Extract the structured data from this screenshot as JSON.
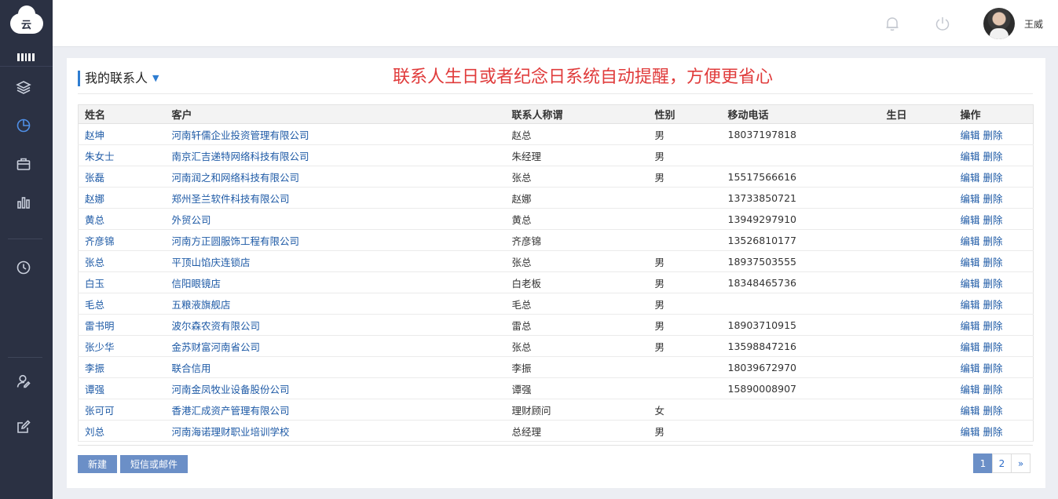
{
  "sidebar": {
    "logo_text": "云",
    "items": [
      {
        "icon": "layers-icon"
      },
      {
        "icon": "pie-chart-icon",
        "active": true
      },
      {
        "icon": "briefcase-icon"
      },
      {
        "icon": "bar-chart-icon"
      },
      {
        "icon": "clock-icon"
      },
      {
        "icon": "user-edit-icon"
      },
      {
        "icon": "edit-icon"
      }
    ]
  },
  "header": {
    "username": "王威"
  },
  "panel": {
    "title": "我的联系人",
    "promo": "联系人生日或者纪念日系统自动提醒，方便更省心"
  },
  "table": {
    "columns": [
      "姓名",
      "客户",
      "联系人称谓",
      "性别",
      "移动电话",
      "生日",
      "操作"
    ],
    "edit_label": "编辑",
    "delete_label": "删除",
    "rows": [
      [
        "赵坤",
        "河南轩儒企业投资管理有限公司",
        "赵总",
        "男",
        "18037197818",
        ""
      ],
      [
        "朱女士",
        "南京汇吉递特网络科技有限公司",
        "朱经理",
        "男",
        "",
        ""
      ],
      [
        "张磊",
        "河南润之和网络科技有限公司",
        "张总",
        "男",
        "15517566616",
        ""
      ],
      [
        "赵娜",
        "郑州圣兰软件科技有限公司",
        "赵娜",
        "",
        "13733850721",
        ""
      ],
      [
        "黄总",
        "外贸公司",
        "黄总",
        "",
        "13949297910",
        ""
      ],
      [
        "齐彦锦",
        "河南方正圆服饰工程有限公司",
        "齐彦锦",
        "",
        "13526810177",
        ""
      ],
      [
        "张总",
        "平顶山馅庆连锁店",
        "张总",
        "男",
        "18937503555",
        ""
      ],
      [
        "白玉",
        "信阳眼镜店",
        "白老板",
        "男",
        "18348465736",
        ""
      ],
      [
        "毛总",
        "五粮液旗舰店",
        "毛总",
        "男",
        "",
        ""
      ],
      [
        "雷书明",
        "波尔森农资有限公司",
        "雷总",
        "男",
        "18903710915",
        ""
      ],
      [
        "张少华",
        "金苏财富河南省公司",
        "张总",
        "男",
        "13598847216",
        ""
      ],
      [
        "李振",
        "联合信用",
        "李振",
        "",
        "18039672970",
        ""
      ],
      [
        "谭强",
        "河南金凤牧业设备股份公司",
        "谭强",
        "",
        "15890008907",
        ""
      ],
      [
        "张可可",
        "香港汇成资产管理有限公司",
        "理财顾问",
        "女",
        "",
        ""
      ],
      [
        "刘总",
        "河南海诺理财职业培训学校",
        "总经理",
        "男",
        "",
        ""
      ]
    ]
  },
  "actions": {
    "new_label": "新建",
    "sms_label": "短信或邮件"
  },
  "pagination": {
    "pages": [
      "1",
      "2"
    ],
    "next": "»",
    "current": "1"
  },
  "colors": {
    "sidebar_bg": "#2b3143",
    "accent": "#2f7dd1",
    "button_bg": "#6b8fc7",
    "promo_text": "#e03b3b",
    "link": "#1e5aa6"
  }
}
